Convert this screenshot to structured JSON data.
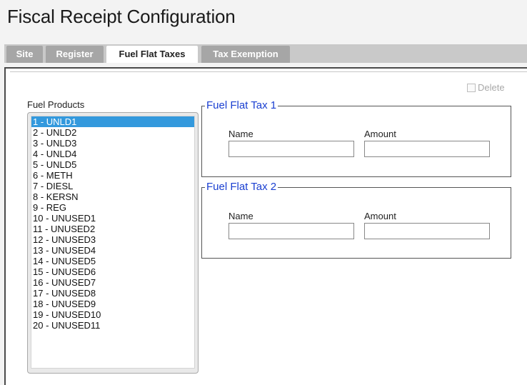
{
  "page": {
    "title": "Fiscal Receipt Configuration"
  },
  "tabs": [
    {
      "label": "Site"
    },
    {
      "label": "Register"
    },
    {
      "label": "Fuel Flat Taxes"
    },
    {
      "label": "Tax Exemption"
    }
  ],
  "active_tab": "Fuel Flat Taxes",
  "delete": {
    "label": "Delete",
    "checked": false,
    "enabled": false
  },
  "fuel_products": {
    "label": "Fuel Products",
    "selected": "1 - UNLD1",
    "items": [
      "1 - UNLD1",
      "2 - UNLD2",
      "3 - UNLD3",
      "4 - UNLD4",
      "5 - UNLD5",
      "6 - METH",
      "7 - DIESL",
      "8 - KERSN",
      "9 - REG",
      "10 - UNUSED1",
      "11 - UNUSED2",
      "12 - UNUSED3",
      "13 - UNUSED4",
      "14 - UNUSED5",
      "15 - UNUSED6",
      "16 - UNUSED7",
      "17 - UNUSED8",
      "18 - UNUSED9",
      "19 - UNUSED10",
      "20 - UNUSED11"
    ]
  },
  "fuel_flat_tax_1": {
    "legend": "Fuel Flat Tax 1",
    "name_label": "Name",
    "name_value": "",
    "amount_label": "Amount",
    "amount_value": ""
  },
  "fuel_flat_tax_2": {
    "legend": "Fuel Flat Tax 2",
    "name_label": "Name",
    "name_value": "",
    "amount_label": "Amount",
    "amount_value": ""
  },
  "colors": {
    "legend": "#1a3fd1",
    "selection": "#3399dd",
    "tab_inactive": "#a6a6a6",
    "tab_bar": "#c9c9c9"
  }
}
